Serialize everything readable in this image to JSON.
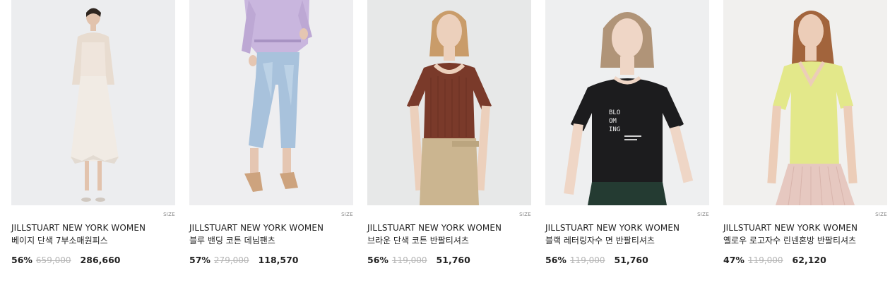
{
  "products": [
    {
      "brand": "JILLSTUART NEW YORK WOMEN",
      "name": "베이지 단색 7부소매원피스",
      "discount": "56%",
      "original_price": "659,000",
      "sale_price": "286,660",
      "size_label": "SIZE",
      "background": "#ecedef"
    },
    {
      "brand": "JILLSTUART NEW YORK WOMEN",
      "name": "블루 밴딩 코튼 데님팬츠",
      "discount": "57%",
      "original_price": "279,000",
      "sale_price": "118,570",
      "size_label": "SIZE",
      "background": "#eeeef0"
    },
    {
      "brand": "JILLSTUART NEW YORK WOMEN",
      "name": "브라운 단색 코튼 반팔티셔츠",
      "discount": "56%",
      "original_price": "119,000",
      "sale_price": "51,760",
      "size_label": "SIZE",
      "background": "#e7e8e8"
    },
    {
      "brand": "JILLSTUART NEW YORK WOMEN",
      "name": "블랙 레터링자수 면 반팔티셔츠",
      "discount": "56%",
      "original_price": "119,000",
      "sale_price": "51,760",
      "size_label": "SIZE",
      "background": "#eeeff0"
    },
    {
      "brand": "JILLSTUART NEW YORK WOMEN",
      "name": "옐로우 로고자수 린넨혼방 반팔티셔츠",
      "discount": "47%",
      "original_price": "119,000",
      "sale_price": "62,120",
      "size_label": "SIZE",
      "background": "#f1f0ee"
    }
  ]
}
